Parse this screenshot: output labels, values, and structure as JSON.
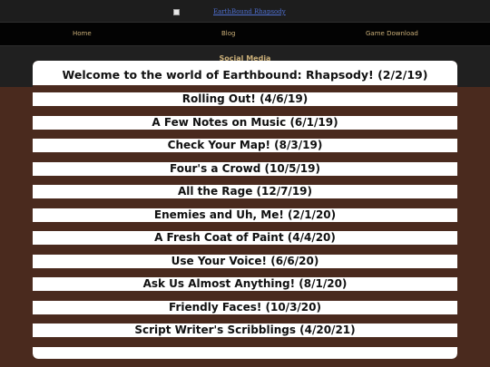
{
  "banner": {
    "logo_alt": "EarthBound Rhapsody"
  },
  "nav": {
    "items": [
      {
        "label": "Home"
      },
      {
        "label": "Blog"
      },
      {
        "label": "Game Download"
      }
    ],
    "social_label": "Social Media"
  },
  "posts": [
    {
      "title": "Welcome to the world of Earthbound: Rhapsody! (2/2/19)"
    },
    {
      "title": "Rolling Out! (4/6/19)"
    },
    {
      "title": "A Few Notes on Music (6/1/19)"
    },
    {
      "title": "Check Your Map! (8/3/19)"
    },
    {
      "title": "Four's a Crowd (10/5/19)"
    },
    {
      "title": "All the Rage (12/7/19)"
    },
    {
      "title": "Enemies and Uh, Me! (2/1/20)"
    },
    {
      "title": "A Fresh Coat of Paint (4/4/20)"
    },
    {
      "title": "Use Your Voice! (6/6/20)"
    },
    {
      "title": "Ask Us Almost Anything! (8/1/20)"
    },
    {
      "title": "Friendly Faces! (10/3/20)"
    },
    {
      "title": "Script Writer's Scribblings (4/20/21)"
    }
  ],
  "colors": {
    "page_background": "#4a2a1e",
    "banner_background": "#1d1d1d",
    "nav_background": "#030303",
    "nav_text": "#c9ae78",
    "post_background": "#ffffff",
    "post_text": "#111111"
  }
}
